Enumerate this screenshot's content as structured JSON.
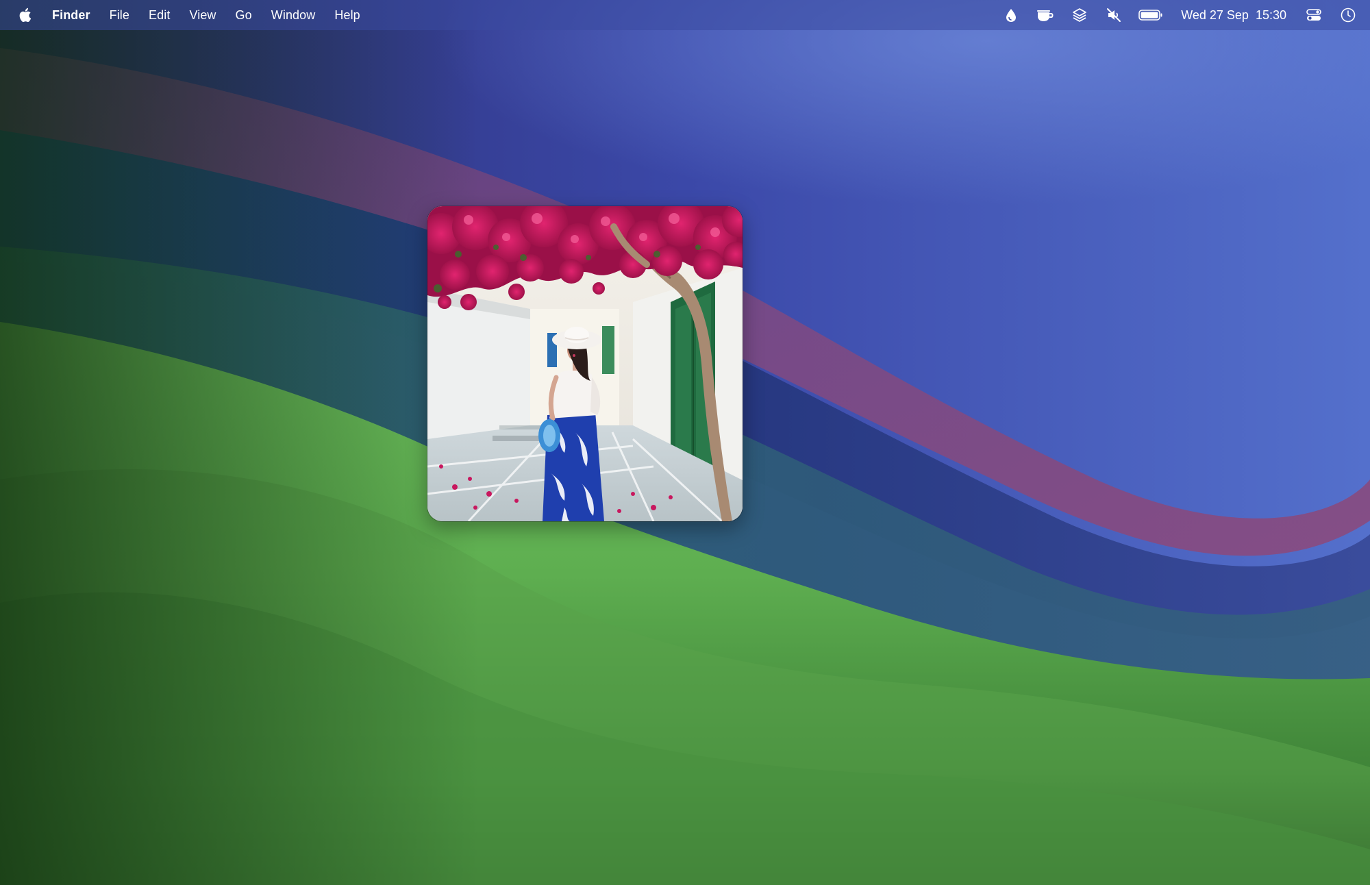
{
  "menubar": {
    "apple_icon": "apple-logo-icon",
    "app_name": "Finder",
    "menus": [
      "File",
      "Edit",
      "View",
      "Go",
      "Window",
      "Help"
    ],
    "status_icons": [
      "drop-icon",
      "coffee-cup-icon",
      "layers-icon",
      "speaker-muted-icon",
      "battery-icon"
    ],
    "clock": {
      "date": "Wed 27 Sep",
      "time": "15:30"
    },
    "right_icons": [
      "control-center-icon",
      "siri-icon"
    ]
  },
  "widget": {
    "type": "photo",
    "subject": "photo-woman-flowers"
  },
  "colors": {
    "menubar_bg": "#3a4aa0",
    "wallpaper_blue": "#3f52b8",
    "wallpaper_magenta": "#7e4a86",
    "wallpaper_green": "#6cc25d",
    "wallpaper_dark_green": "#1f4a1c"
  }
}
